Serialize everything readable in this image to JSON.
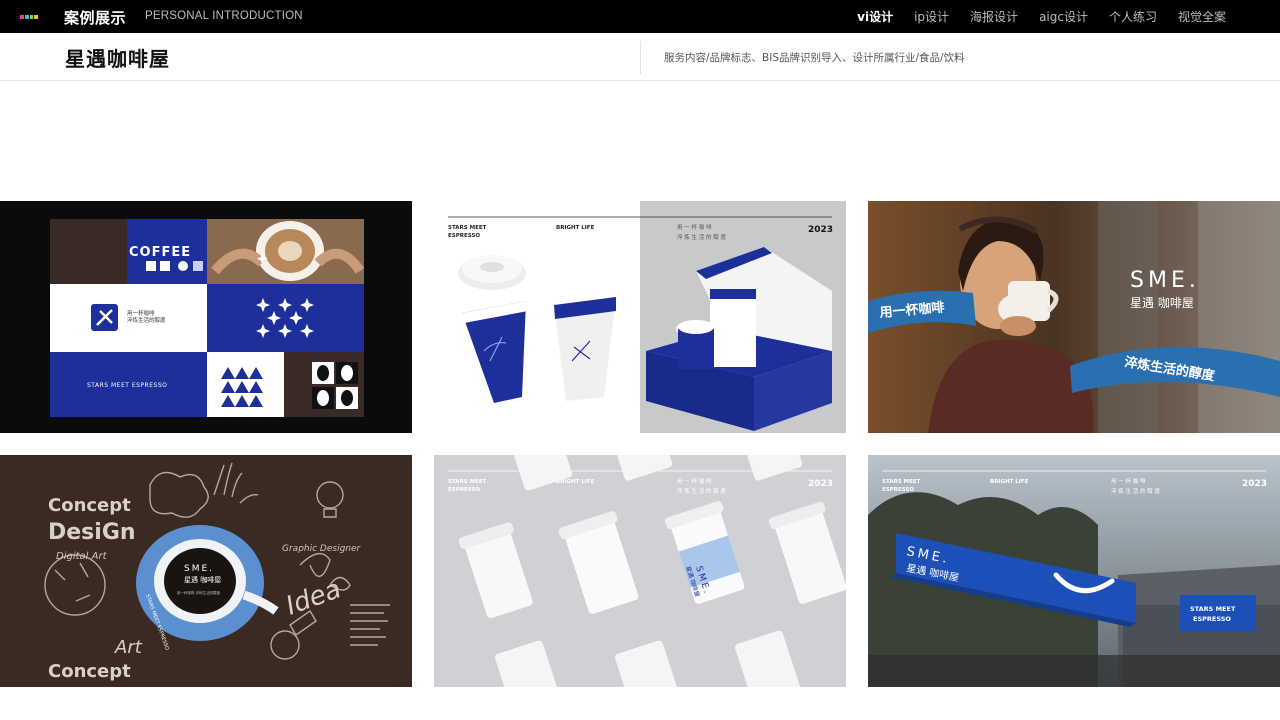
{
  "header": {
    "site_title": "案例展示",
    "site_subtitle": "PERSONAL INTRODUCTION",
    "nav": [
      {
        "label": "vi设计",
        "active": true
      },
      {
        "label": "ip设计",
        "active": false
      },
      {
        "label": "海报设计",
        "active": false
      },
      {
        "label": "aigc设计",
        "active": false
      },
      {
        "label": "个人练习",
        "active": false
      },
      {
        "label": "视觉全案",
        "active": false
      }
    ]
  },
  "project": {
    "title": "星遇咖啡屋",
    "service_info": "服务内容/品牌标志、BIS品牌识别导入、设计所属行业/食品/饮料"
  },
  "gallery": {
    "tile1": {
      "coffee": "COFFEE",
      "slogan_line1": "用一杯咖啡",
      "slogan_line2": "淬炼生活的醇度",
      "stars": "STARS MEET ESPRESSO"
    },
    "tile2": {
      "stars": "STARS MEET",
      "espresso": "ESPRESSO",
      "bright": "BRIGHT LIFE",
      "cn1": "用 一 杯 咖 啡",
      "cn2": "淬 炼 生 活 的 醇 度",
      "year": "2023"
    },
    "tile3": {
      "sme": "SME.",
      "brand": "星遇 咖啡屋",
      "ribbon1": "用一杯咖啡",
      "ribbon2": "淬炼生活的醇度"
    },
    "tile4": {
      "word1": "Concept",
      "word2": "DesiGn",
      "word3": "Art",
      "word4": "Concept",
      "word5": "Idea",
      "word6": "Graphic Designer",
      "word7": "Digital Art",
      "sme": "SME.",
      "brand": "星遇 咖啡屋",
      "cup_line": "用一杯咖啡 淬炼生活的醇度",
      "saucer": "STARS MEET ESPRESSO"
    },
    "tile5": {
      "stars": "STARS MEET",
      "espresso": "ESPRESSO",
      "bright": "BRIGHT LIFE",
      "cn1": "用 一 杯 咖 啡",
      "cn2": "淬 炼 生 活 的 醇 度",
      "year": "2023",
      "cup_mark": "SME.",
      "cup_brand": "星遇 咖啡屋"
    },
    "tile6": {
      "stars": "STARS MEET",
      "espresso": "ESPRESSO",
      "bright": "BRIGHT LIFE",
      "cn1": "用 一 杯 咖 啡",
      "cn2": "淬 炼 生 活 的 醇 度",
      "year": "2023",
      "sme": "SME.",
      "brand": "星遇 咖啡屋",
      "sign_line1": "STARS MEET",
      "sign_line2": "ESPRESSO"
    }
  },
  "colors": {
    "brand_blue": "#1d2f9a",
    "ribbon_blue": "#2a6fb0",
    "logo_mark": [
      "#e83e8c",
      "#3fb6e8",
      "#8bd34a",
      "#f2c230"
    ]
  }
}
